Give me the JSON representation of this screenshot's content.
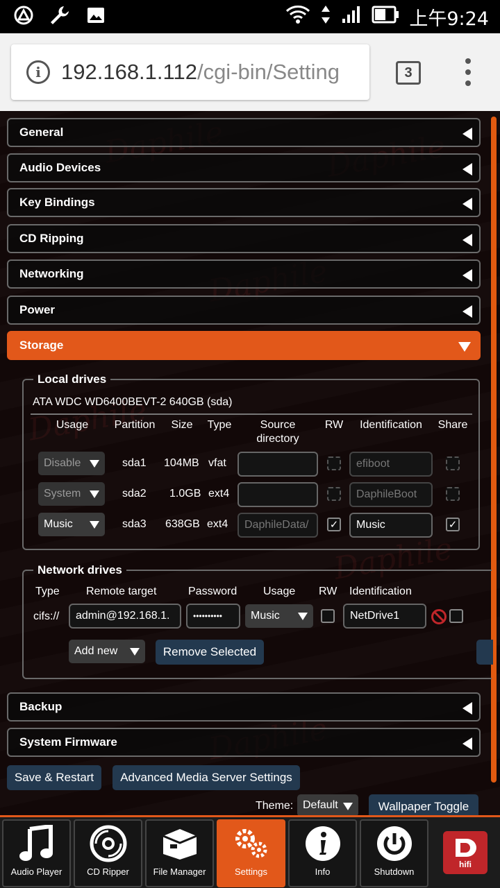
{
  "status_bar": {
    "time": "上午9:24"
  },
  "browser": {
    "url_host": "192.168.1.112",
    "url_path": "/cgi-bin/Setting",
    "tab_count": "3"
  },
  "sections": {
    "general": "General",
    "audio_devices": "Audio Devices",
    "key_bindings": "Key Bindings",
    "cd_ripping": "CD Ripping",
    "networking": "Networking",
    "power": "Power",
    "storage": "Storage",
    "backup": "Backup",
    "system_firmware": "System Firmware"
  },
  "local_drives": {
    "legend": "Local drives",
    "drive_name": "ATA WDC WD6400BEVT-2 640GB (sda)",
    "headers": {
      "usage": "Usage",
      "partition": "Partition",
      "size": "Size",
      "type": "Type",
      "source_1": "Source",
      "source_2": "directory",
      "rw": "RW",
      "identification": "Identification",
      "share": "Share"
    },
    "rows": [
      {
        "usage": "Disable",
        "partition": "sda1",
        "size": "104MB",
        "type": "vfat",
        "source": "",
        "rw": "",
        "identification": "efiboot",
        "share": ""
      },
      {
        "usage": "System",
        "partition": "sda2",
        "size": "1.0GB",
        "type": "ext4",
        "source": "",
        "rw": "",
        "identification": "DaphileBoot",
        "share": ""
      },
      {
        "usage": "Music",
        "partition": "sda3",
        "size": "638GB",
        "type": "ext4",
        "source": "DaphileData/",
        "rw": "✓",
        "identification": "Music",
        "share": "✓"
      }
    ]
  },
  "network_drives": {
    "legend": "Network drives",
    "headers": {
      "type": "Type",
      "remote_target": "Remote target",
      "password": "Password",
      "usage": "Usage",
      "rw": "RW",
      "identification": "Identification"
    },
    "row": {
      "type": "cifs://",
      "remote_target": "admin@192.168.1.",
      "password": "••••••••••",
      "usage": "Music",
      "identification": "NetDrive1"
    },
    "add_new": "Add new",
    "remove_selected": "Remove Selected"
  },
  "footer": {
    "save_restart": "Save & Restart",
    "advanced": "Advanced Media Server Settings",
    "theme_label": "Theme:",
    "theme_value": "Default",
    "wallpaper_toggle": "Wallpaper Toggle"
  },
  "bottom_nav": {
    "audio_player": "Audio Player",
    "cd_ripper": "CD Ripper",
    "file_manager": "File Manager",
    "settings": "Settings",
    "info": "Info",
    "shutdown": "Shutdown",
    "logo_text": "hifi"
  },
  "colors": {
    "accent": "#e2581a",
    "button": "#23394f",
    "logo": "#c0262a"
  }
}
